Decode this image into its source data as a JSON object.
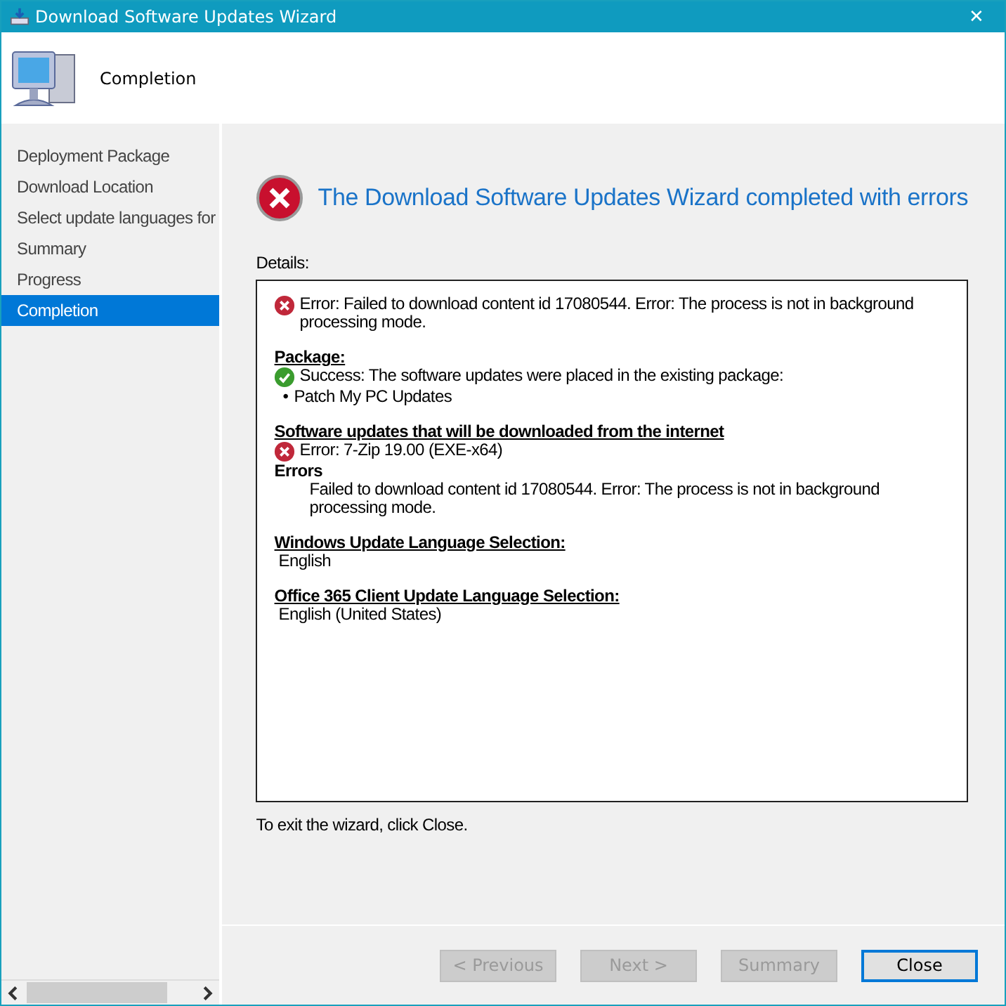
{
  "window": {
    "title": "Download Software Updates Wizard",
    "close": "✕"
  },
  "header": {
    "title": "Completion"
  },
  "sidebar": {
    "items": [
      {
        "label": "Deployment Package",
        "selected": false
      },
      {
        "label": "Download Location",
        "selected": false
      },
      {
        "label": "Select update languages for",
        "selected": false
      },
      {
        "label": "Summary",
        "selected": false
      },
      {
        "label": "Progress",
        "selected": false
      },
      {
        "label": "Completion",
        "selected": true
      }
    ]
  },
  "main": {
    "heading": "The Download Software Updates Wizard completed with errors",
    "details_label": "Details:",
    "details": [
      {
        "lines": [
          {
            "kind": "error",
            "text": "Error: Failed to download content id 17080544. Error: The process is not in background processing mode."
          }
        ]
      },
      {
        "lines": [
          {
            "kind": "heading",
            "text": "Package:"
          },
          {
            "kind": "success",
            "text": "Success: The software updates were placed in the existing package:"
          },
          {
            "kind": "bullet",
            "marker": "•",
            "text": "Patch My PC Updates"
          }
        ]
      },
      {
        "lines": [
          {
            "kind": "heading",
            "text": "Software updates that will be downloaded from the internet"
          },
          {
            "kind": "error",
            "text": "Error: 7-Zip 19.00 (EXE-x64)"
          },
          {
            "kind": "label",
            "text": "Errors"
          },
          {
            "kind": "indent",
            "text": "Failed to download content id 17080544. Error: The process is not in background processing mode."
          }
        ]
      },
      {
        "lines": [
          {
            "kind": "heading",
            "text": "Windows Update Language Selection:"
          },
          {
            "kind": "plain",
            "text": "English"
          }
        ]
      },
      {
        "lines": [
          {
            "kind": "heading",
            "text": "Office 365 Client Update Language Selection:"
          },
          {
            "kind": "plain",
            "text": "English (United States)"
          }
        ]
      }
    ],
    "exit_hint": "To exit the wizard, click Close."
  },
  "buttons": [
    {
      "label": "< Previous",
      "disabled": true
    },
    {
      "label": "Next >",
      "disabled": true
    },
    {
      "label": "Summary",
      "disabled": true
    },
    {
      "label": "Close",
      "disabled": false
    }
  ]
}
